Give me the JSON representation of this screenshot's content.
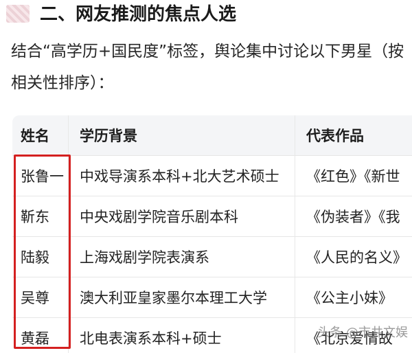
{
  "section": {
    "title": "二、网友推测的焦点人选"
  },
  "intro": {
    "text": "结合“高学历+国民度”标签，舆论集中讨论以下男星（按相关性排序）："
  },
  "table": {
    "headers": [
      "姓名",
      "学历背景",
      "代表作品"
    ],
    "rows": [
      [
        "张鲁一",
        "中戏导演系本科+北大艺术硕士",
        "《红色》《新世"
      ],
      [
        "靳东",
        "中央戏剧学院音乐剧本科",
        "《伪装者》《我"
      ],
      [
        "陆毅",
        "上海戏剧学院表演系",
        "《人民的名义》"
      ],
      [
        "吴尊",
        "澳大利亚皇家墨尔本理工大学",
        "《公主小妹》"
      ],
      [
        "黄磊",
        "北电表演系本科+硕士",
        "《北京爱情故"
      ]
    ]
  },
  "watermark": {
    "text": "头条 @市井文娱"
  }
}
